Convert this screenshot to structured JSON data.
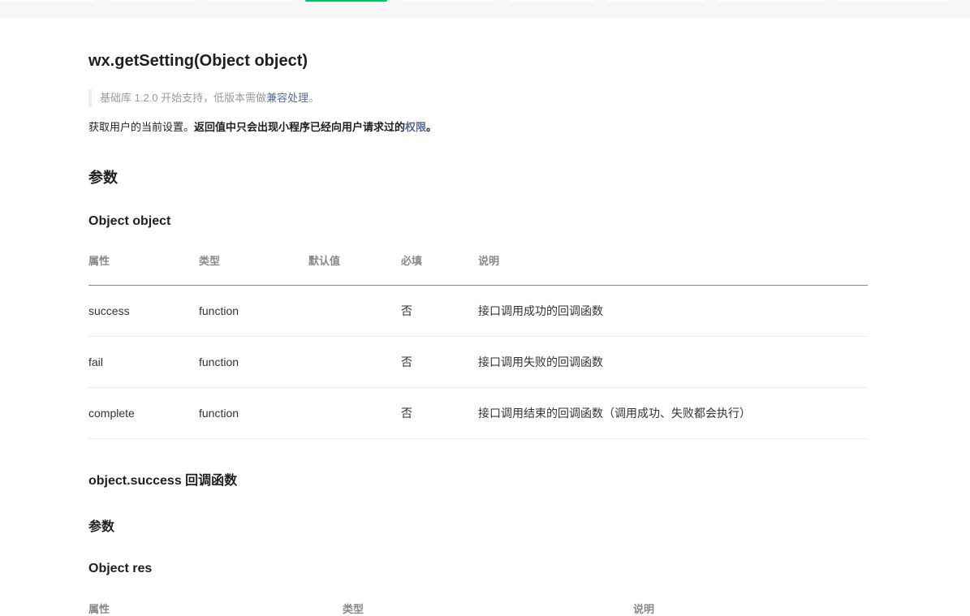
{
  "topnav": {
    "items": [
      "",
      "",
      "",
      "",
      "",
      "",
      "",
      "",
      ""
    ],
    "active_index": 3,
    "active_color": "#07c160"
  },
  "page": {
    "title": "wx.getSetting(Object object)",
    "support_prefix": "基础库 1.2.0 开始支持，低版本需做",
    "support_link": "兼容处理",
    "support_suffix": "。",
    "desc_plain": "获取用户的当前设置。",
    "desc_bold": "返回值中只会出现小程序已经向用户请求过的",
    "desc_link": "权限",
    "desc_end": "。",
    "section_params": "参数",
    "object_heading": "Object object",
    "table": {
      "headers": [
        "属性",
        "类型",
        "默认值",
        "必填",
        "说明"
      ],
      "rows": [
        [
          "success",
          "function",
          "",
          "否",
          "接口调用成功的回调函数"
        ],
        [
          "fail",
          "function",
          "",
          "否",
          "接口调用失败的回调函数"
        ],
        [
          "complete",
          "function",
          "",
          "否",
          "接口调用结束的回调函数（调用成功、失败都会执行）"
        ]
      ]
    },
    "success_heading": "object.success 回调函数",
    "success_params": "参数",
    "res_heading": "Object res",
    "res_table_headers": [
      "属性",
      "类型",
      "说明"
    ]
  },
  "colors": {
    "link": "#576b95",
    "accent": "#07c160"
  }
}
